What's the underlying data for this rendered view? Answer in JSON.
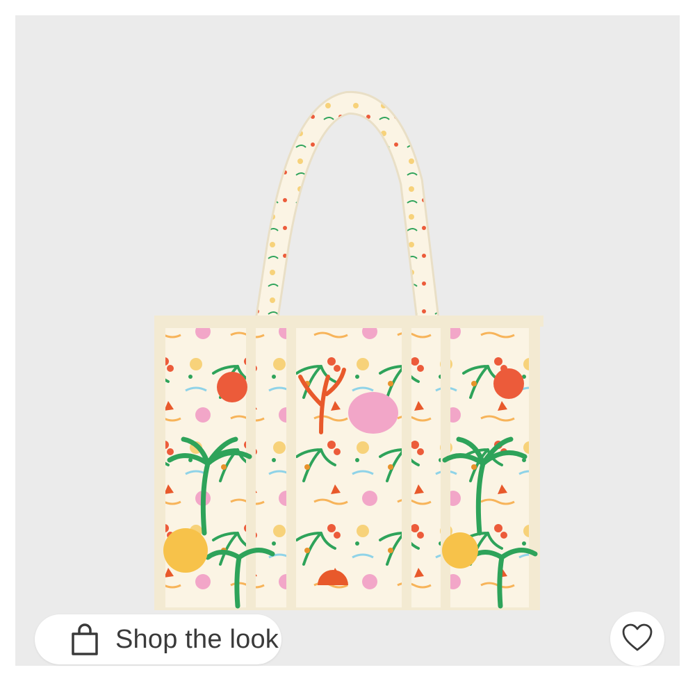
{
  "shop_button": {
    "label": "Shop the look",
    "icon": "shopping-bag-icon"
  },
  "like_button": {
    "icon": "heart-outline-icon"
  },
  "product_image": {
    "subject": "tote-bag"
  },
  "colors": {
    "background": "#ebebeb",
    "fringe": "#f3ead2",
    "palm_green": "#2ea35a",
    "coral": "#ec5b3a",
    "yellow": "#f7d27a",
    "pink": "#f2a6c8"
  }
}
